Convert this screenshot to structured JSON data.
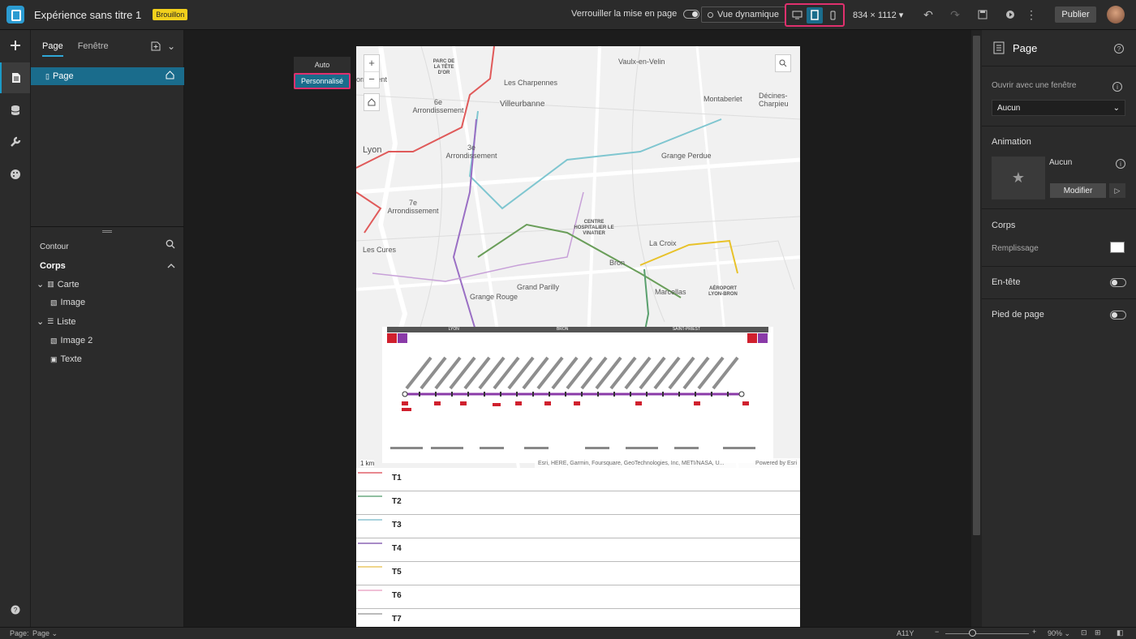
{
  "header": {
    "title": "Expérience sans titre 1",
    "status_badge": "Brouillon",
    "lock_layout_label": "Verrouiller la mise en page",
    "dynamic_view_label": "Vue dynamique",
    "size_label": "834 × 1112",
    "publish_label": "Publier"
  },
  "left_panel": {
    "tabs": [
      "Page",
      "Fenêtre"
    ],
    "active_tab": "Page",
    "pages": [
      {
        "label": "Page"
      }
    ],
    "outline_title": "Contour",
    "outline_section": "Corps",
    "outline_items": [
      {
        "label": "Carte"
      },
      {
        "label": "Image"
      },
      {
        "label": "Liste"
      },
      {
        "label": "Image 2"
      },
      {
        "label": "Texte"
      }
    ]
  },
  "size_popup": {
    "options": [
      "Auto",
      "Personnalisé"
    ],
    "selected": "Personnalisé"
  },
  "map": {
    "labels": [
      "Vaulx-en-Velin",
      "Les Charpennes",
      "Villeurbanne",
      "Montaberlet",
      "Décines-Charpieu",
      "6e Arrondissement",
      "3e Arrondissement",
      "Lyon",
      "Grange Perdue",
      "7e Arrondissement",
      "Les Cures",
      "La Croix",
      "Bron",
      "Grand Parilly",
      "Marcellas",
      "Grange Rouge",
      "CENTRE HOSPITALIER LE VINATIER",
      "AÉROPORT LYON-BRON",
      "PARC DE LA TÊTE D'OR",
      "ornement"
    ],
    "tram_header": [
      "LYON",
      "BRON",
      "SAINT-PRIEST"
    ],
    "scale_label": "1 km",
    "attribution": "Esri, HERE, Garmin, Foursquare, GeoTechnologies, Inc, METI/NASA, U...",
    "powered": "Powered by Esri"
  },
  "list": {
    "items": [
      {
        "label": "T1",
        "color": "#e8888f"
      },
      {
        "label": "T2",
        "color": "#8fbfa0"
      },
      {
        "label": "T3",
        "color": "#a9d3dd"
      },
      {
        "label": "T4",
        "color": "#a88bc7"
      },
      {
        "label": "T5",
        "color": "#f0d68c"
      },
      {
        "label": "T6",
        "color": "#f0c0d6"
      },
      {
        "label": "T7",
        "color": "#bbbbbb"
      }
    ]
  },
  "right_panel": {
    "title": "Page",
    "open_with_window_label": "Ouvrir avec une fenêtre",
    "open_with_window_value": "Aucun",
    "animation_label": "Animation",
    "animation_value": "Aucun",
    "modify_label": "Modifier",
    "body_label": "Corps",
    "fill_label": "Remplissage",
    "header_label": "En-tête",
    "footer_label": "Pied de page"
  },
  "bottom_bar": {
    "page_label": "Page:",
    "page_value": "Page",
    "a11y": "A11Y",
    "zoom": "90%"
  }
}
